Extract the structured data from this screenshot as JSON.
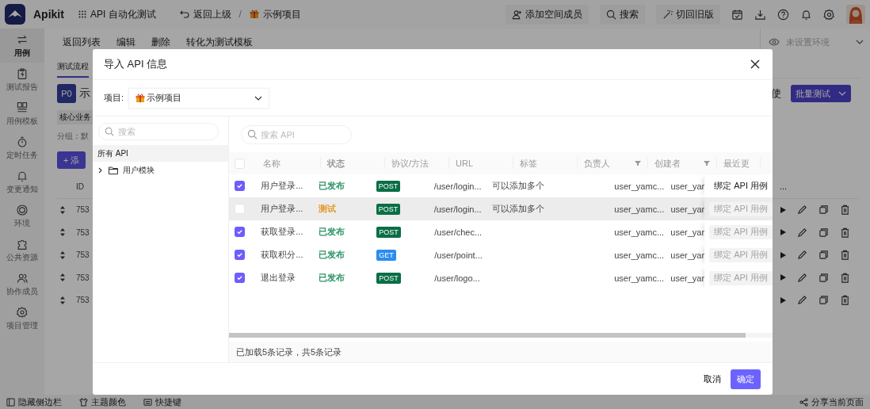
{
  "topbar": {
    "app_name": "Apikit",
    "module": "API 自动化测试",
    "back": "返回上级",
    "separator": "/",
    "project": "示例项目",
    "actions": [
      {
        "kind": "invite",
        "label": "添加空间成员"
      },
      {
        "kind": "search",
        "label": "搜索"
      },
      {
        "kind": "switch",
        "label": "切回旧版"
      }
    ]
  },
  "sidebar": {
    "items": [
      {
        "kind": "case",
        "label": "用例",
        "selected": true
      },
      {
        "kind": "report",
        "label": "测试报告",
        "selected": false
      },
      {
        "kind": "template",
        "label": "用例模板",
        "selected": false
      },
      {
        "kind": "timer",
        "label": "定时任务",
        "selected": false
      },
      {
        "kind": "notice",
        "label": "变更通知",
        "selected": false
      },
      {
        "kind": "env",
        "label": "环境",
        "selected": false
      },
      {
        "kind": "resource",
        "label": "公共资源",
        "selected": false
      },
      {
        "kind": "team",
        "label": "协作成员",
        "selected": false
      },
      {
        "kind": "manage",
        "label": "项目管理",
        "selected": false
      }
    ]
  },
  "toolbar": [
    "返回列表",
    "编辑",
    "删除",
    "转化为测试模板"
  ],
  "environment": {
    "value": "未设置环境"
  },
  "case": {
    "tab": "测试流程",
    "priority": "P0",
    "title": "示",
    "tag": "核心业务",
    "group": "分组：默",
    "add_button": "+ 添",
    "side_text": "使",
    "batch_button": "批量测试",
    "id_header": "ID",
    "more": "...",
    "steps": [
      "753",
      "753",
      "753",
      "753",
      "753"
    ]
  },
  "footer": {
    "items": [
      {
        "kind": "sidebar",
        "label": "隐藏侧边栏"
      },
      {
        "kind": "theme",
        "label": "主题颜色"
      },
      {
        "kind": "keys",
        "label": "快捷键"
      }
    ],
    "share": "分享当前页面"
  },
  "modal": {
    "title": "导入 API 信息",
    "project_label": "项目:",
    "project": "示例项目",
    "tree_search": {
      "placeholder": "搜索"
    },
    "tree": [
      {
        "label": "所有 API",
        "selected": true,
        "children": [
          {
            "label": "用户模块",
            "selected": false,
            "expanded": false
          }
        ]
      }
    ],
    "api_search": {
      "placeholder": "搜索 API"
    },
    "select_all": {
      "checked": false
    },
    "columns": [
      {
        "label": "名称",
        "filter": false
      },
      {
        "label": "状态",
        "filter": false
      },
      {
        "label": "协议/方法",
        "filter": false
      },
      {
        "label": "URL",
        "filter": false
      },
      {
        "label": "标签",
        "filter": false
      },
      {
        "label": "负责人",
        "filter": true
      },
      {
        "label": "创建者",
        "filter": true
      },
      {
        "label": "最近更",
        "filter": false
      }
    ],
    "rows": [
      {
        "checked": true,
        "highlighted": false,
        "name": "用户登录...",
        "status": {
          "label": "已发布",
          "color": "#2e9568"
        },
        "method": "POST",
        "url": "/user/login...",
        "tag": "可以添加多个",
        "creator": "user_yamc...",
        "updater": "user_yar",
        "bind": "绑定 API 用例",
        "bind_disabled": false
      },
      {
        "checked": false,
        "highlighted": true,
        "name": "用户登录...",
        "status": {
          "label": "测试",
          "color": "#e39a2b"
        },
        "method": "POST",
        "url": "/user/login...",
        "tag": "可以添加多个",
        "creator": "user_yamc...",
        "updater": "user_yar",
        "bind": "绑定 API 用例",
        "bind_disabled": true
      },
      {
        "checked": true,
        "highlighted": false,
        "name": "获取登录...",
        "status": {
          "label": "已发布",
          "color": "#2e9568"
        },
        "method": "POST",
        "url": "/user/chec...",
        "creator": "user_yamc...",
        "updater": "user_yar",
        "bind": "绑定 API 用例",
        "bind_disabled": true
      },
      {
        "checked": true,
        "highlighted": false,
        "name": "获取积分...",
        "status": {
          "label": "已发布",
          "color": "#2e9568"
        },
        "method": "GET",
        "url": "/user/point...",
        "creator": "user_yamc...",
        "updater": "user_yar",
        "bind": "绑定 API 用例",
        "bind_disabled": true
      },
      {
        "checked": true,
        "highlighted": false,
        "name": "退出登录",
        "status": {
          "label": "已发布",
          "color": "#2e9568"
        },
        "method": "POST",
        "url": "/user/logo...",
        "creator": "user_yamc...",
        "updater": "user_yar",
        "bind": "绑定 API 用例",
        "bind_disabled": true
      }
    ],
    "footer_info": "已加载5条记录，共5条记录",
    "cancel": "取消",
    "confirm": "确定"
  }
}
